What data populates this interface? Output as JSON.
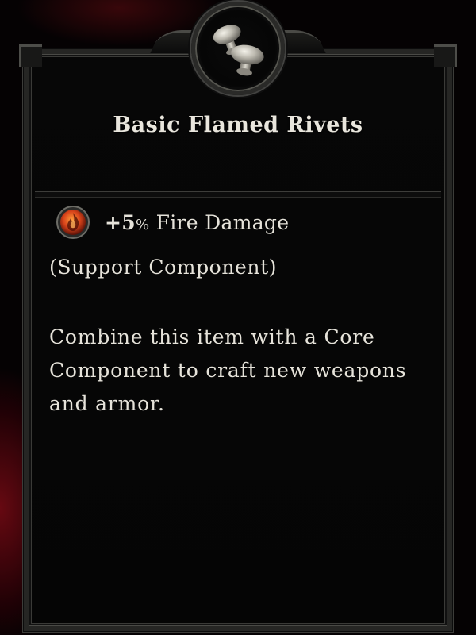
{
  "item": {
    "name": "Basic Flamed Rivets",
    "icon": "rivets-icon"
  },
  "stat": {
    "icon": "fire-damage-icon",
    "value": "+5",
    "unit": "%",
    "label": "Fire Damage"
  },
  "subtype": "(Support Component)",
  "description": "Combine this item with a Core Component to craft new weapons and armor.",
  "colors": {
    "text": "#e6e3da",
    "frame": "#262624",
    "fire_orb": "#d8431a"
  }
}
